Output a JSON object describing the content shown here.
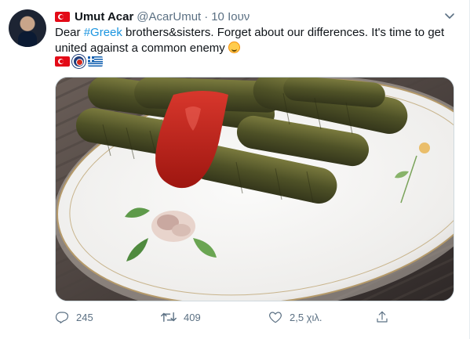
{
  "tweet": {
    "author_name": "Umut Acar",
    "handle": "@AcarUmut",
    "separator": "·",
    "time": "10 Ιουν",
    "text_prefix": "Dear ",
    "hashtag": "#Greek",
    "text_body": "  brothers&sisters. Forget about our differences. It's time to get united against a common enemy",
    "emoji": "smiling-face-emoji",
    "flags": [
      "turkey-flag-icon",
      "greek-navy-roundel-icon",
      "greece-flag-icon"
    ]
  },
  "actions": {
    "replies": "245",
    "retweets": "409",
    "likes": "2,5 χιλ."
  },
  "colors": {
    "link": "#1b95e0",
    "secondary_text": "#5b7083",
    "turkey_red": "#e30a17",
    "greek_blue": "#0d5eaf"
  }
}
